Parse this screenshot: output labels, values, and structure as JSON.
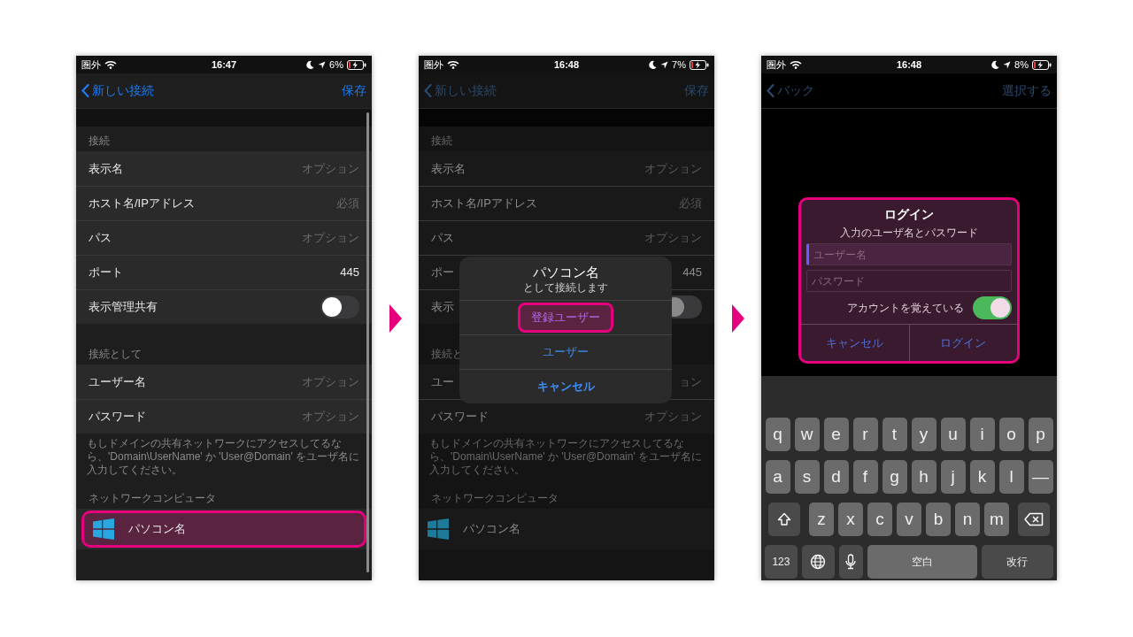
{
  "phones": [
    {
      "status_bar": {
        "carrier": "圏外",
        "time": "16:47",
        "battery": "6%"
      },
      "nav": {
        "back": "新しい接続",
        "action": "保存"
      },
      "scrollbar": true,
      "sections": [
        {
          "header": "接続",
          "rows": [
            {
              "kind": "placeholder",
              "label": "表示名",
              "value": "オプション"
            },
            {
              "kind": "placeholder",
              "label": "ホスト名/IPアドレス",
              "value": "必須"
            },
            {
              "kind": "placeholder",
              "label": "パス",
              "value": "オプション"
            },
            {
              "kind": "value",
              "label": "ポート",
              "value": "445"
            },
            {
              "kind": "toggle",
              "label": "表示管理共有",
              "on": false
            }
          ]
        },
        {
          "header": "接続として",
          "rows": [
            {
              "kind": "placeholder",
              "label": "ユーザー名",
              "value": "オプション"
            },
            {
              "kind": "placeholder",
              "label": "パスワード",
              "value": "オプション"
            }
          ],
          "footer": "もしドメインの共有ネットワークにアクセスしてるなら、'Domain\\UserName' か 'User@Domain' をユーザ名に入力してください。"
        },
        {
          "header": "ネットワークコンピュータ",
          "rows": [
            {
              "kind": "computer",
              "label": "パソコン名",
              "highlighted": true
            }
          ]
        }
      ]
    },
    {
      "status_bar": {
        "carrier": "圏外",
        "time": "16:48",
        "battery": "7%"
      },
      "nav": {
        "back": "新しい接続",
        "action": "保存"
      },
      "scrollbar": false,
      "sections": [
        {
          "header": "接続",
          "rows": [
            {
              "kind": "placeholder",
              "label": "表示名",
              "value": "オプション"
            },
            {
              "kind": "placeholder",
              "label": "ホスト名/IPアドレス",
              "value": "必須"
            },
            {
              "kind": "placeholder",
              "label": "パス",
              "value": "オプション"
            },
            {
              "kind": "value",
              "label": "ポー",
              "value": "445"
            },
            {
              "kind": "toggle",
              "label": "表示",
              "on": false
            }
          ]
        },
        {
          "header": "接続と",
          "rows": [
            {
              "kind": "placeholder",
              "label": "ユー",
              "value": "ョン"
            },
            {
              "kind": "placeholder",
              "label": "パスワード",
              "value": "オプション"
            }
          ],
          "footer": "もしドメインの共有ネットワークにアクセスしてるなら、'Domain\\UserName' か 'User@Domain' をユーザ名に入力してください。"
        },
        {
          "header": "ネットワークコンピュータ",
          "rows": [
            {
              "kind": "computer",
              "label": "パソコン名",
              "highlighted": false
            }
          ]
        }
      ],
      "dialog": {
        "title": "パソコン名",
        "message": "として接続します",
        "actions": [
          {
            "label": "登録ユーザー",
            "kind": "default",
            "highlighted": true
          },
          {
            "label": "ユーザー",
            "kind": "default",
            "highlighted": false
          },
          {
            "label": "キャンセル",
            "kind": "cancel",
            "highlighted": false
          }
        ]
      }
    },
    {
      "status_bar": {
        "carrier": "圏外",
        "time": "16:48",
        "battery": "8%"
      },
      "nav": {
        "back": "バック",
        "action": "選択する"
      },
      "login": {
        "highlighted": true,
        "title": "ログイン",
        "message": "入力のユーザ名とパスワード",
        "fields": [
          {
            "placeholder": "ユーザー名",
            "focused": true
          },
          {
            "placeholder": "パスワード",
            "focused": false
          }
        ],
        "remember": {
          "label": "アカウントを覚えている",
          "on": true
        },
        "buttons": [
          "キャンセル",
          "ログイン"
        ]
      },
      "keyboard": [
        [
          {
            "kind": "letter",
            "label": "q"
          },
          {
            "kind": "letter",
            "label": "w"
          },
          {
            "kind": "letter",
            "label": "e"
          },
          {
            "kind": "letter",
            "label": "r"
          },
          {
            "kind": "letter",
            "label": "t"
          },
          {
            "kind": "letter",
            "label": "y"
          },
          {
            "kind": "letter",
            "label": "u"
          },
          {
            "kind": "letter",
            "label": "i"
          },
          {
            "kind": "letter",
            "label": "o"
          },
          {
            "kind": "letter",
            "label": "p"
          }
        ],
        [
          {
            "kind": "letter",
            "label": "a"
          },
          {
            "kind": "letter",
            "label": "s"
          },
          {
            "kind": "letter",
            "label": "d"
          },
          {
            "kind": "letter",
            "label": "f"
          },
          {
            "kind": "letter",
            "label": "g"
          },
          {
            "kind": "letter",
            "label": "h"
          },
          {
            "kind": "letter",
            "label": "j"
          },
          {
            "kind": "letter",
            "label": "k"
          },
          {
            "kind": "letter",
            "label": "l"
          },
          {
            "kind": "letter",
            "label": "—"
          }
        ],
        [
          {
            "kind": "shift"
          },
          {
            "kind": "letter",
            "label": "z"
          },
          {
            "kind": "letter",
            "label": "x"
          },
          {
            "kind": "letter",
            "label": "c"
          },
          {
            "kind": "letter",
            "label": "v"
          },
          {
            "kind": "letter",
            "label": "b"
          },
          {
            "kind": "letter",
            "label": "n"
          },
          {
            "kind": "letter",
            "label": "m"
          },
          {
            "kind": "delete"
          }
        ],
        [
          {
            "kind": "mode",
            "label": "123"
          },
          {
            "kind": "globe"
          },
          {
            "kind": "mic"
          },
          {
            "kind": "space",
            "label": "空白"
          },
          {
            "kind": "return",
            "label": "改行"
          }
        ]
      ]
    }
  ]
}
